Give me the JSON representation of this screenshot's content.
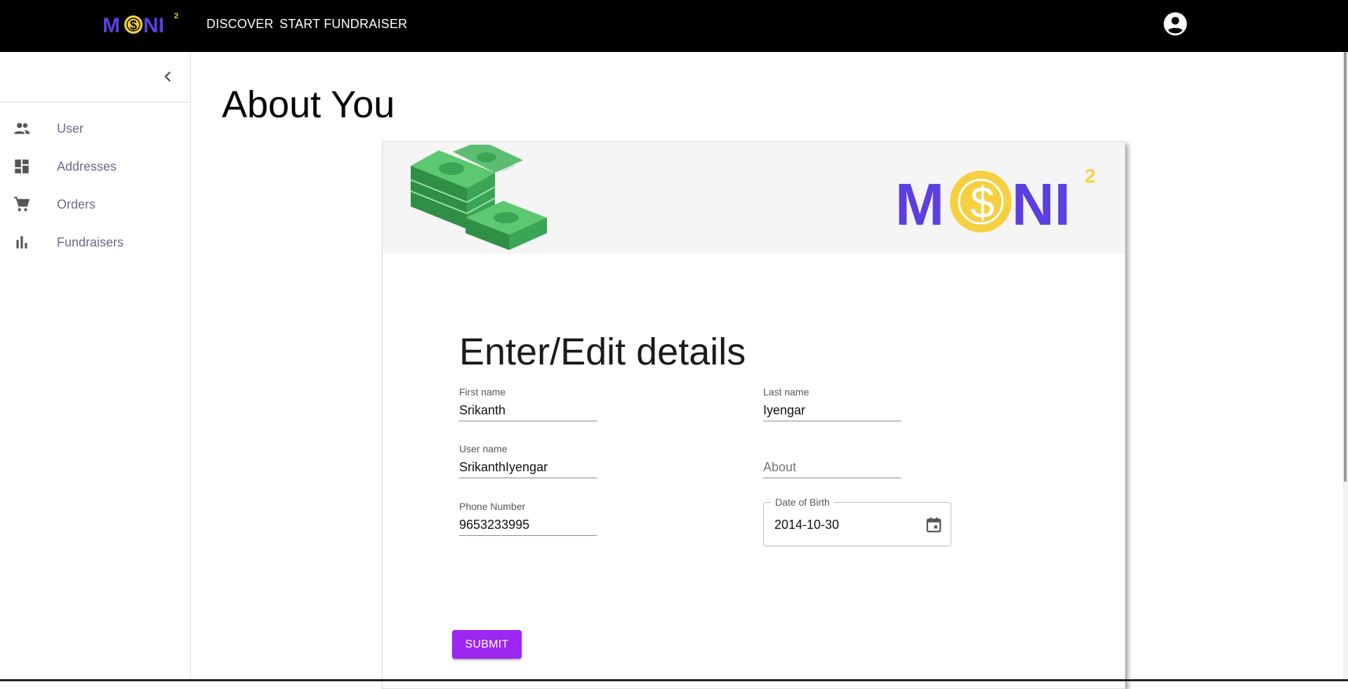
{
  "topbar": {
    "brand_logo_text": "MONI²",
    "nav": [
      {
        "label": "DISCOVER"
      },
      {
        "label": "START FUNDRAISER"
      }
    ],
    "account_icon": "account-circle-icon"
  },
  "sidebar": {
    "collapse_icon": "chevron-left-icon",
    "items": [
      {
        "label": "User",
        "icon": "people-icon"
      },
      {
        "label": "Addresses",
        "icon": "dashboard-icon"
      },
      {
        "label": "Orders",
        "icon": "cart-icon"
      },
      {
        "label": "Fundraisers",
        "icon": "bar-chart-icon"
      }
    ]
  },
  "page": {
    "title": "About You"
  },
  "card": {
    "banner_logo_text": "MONI²",
    "form_title": "Enter/Edit details",
    "fields": {
      "first_name": {
        "label": "First name",
        "value": "Srikanth"
      },
      "last_name": {
        "label": "Last name",
        "value": "Iyengar"
      },
      "user_name": {
        "label": "User name",
        "value": "SrikanthIyengar"
      },
      "about": {
        "placeholder": "About",
        "value": ""
      },
      "phone": {
        "label": "Phone Number",
        "value": "9653233995"
      },
      "dob": {
        "label": "Date of Birth",
        "value": "2014-10-30"
      }
    },
    "submit_label": "SUBMIT"
  },
  "colors": {
    "accent": "#9c27f0",
    "logo_purple": "#5b3fe0",
    "logo_gold": "#f5d142",
    "money_green": "#3aa655"
  }
}
